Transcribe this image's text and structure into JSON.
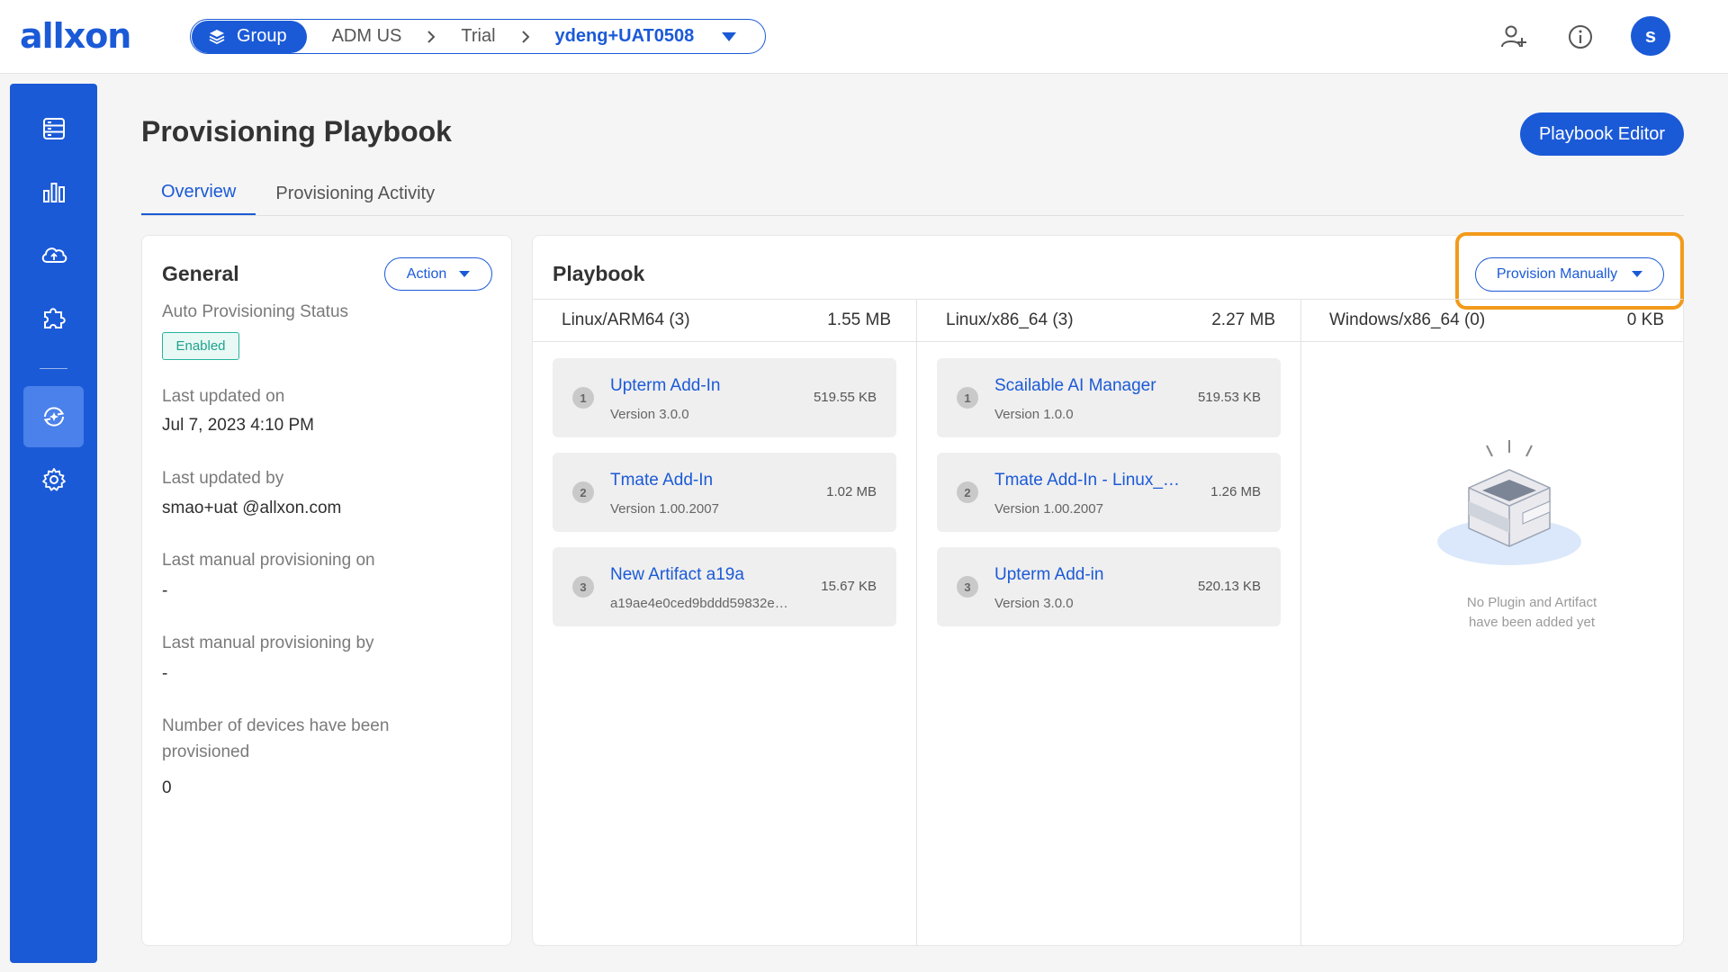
{
  "header": {
    "logo": "allxon",
    "breadcrumb": {
      "group_label": "Group",
      "items": [
        "ADM US",
        "Trial"
      ],
      "current": "ydeng+UAT0508"
    },
    "avatar_initial": "s"
  },
  "sidebar": {
    "items": [
      "devices",
      "analytics",
      "cloud-sync",
      "plugins",
      "provisioning",
      "settings"
    ],
    "active": "provisioning"
  },
  "page": {
    "title": "Provisioning Playbook",
    "editor_button": "Playbook Editor",
    "tabs": [
      {
        "label": "Overview",
        "active": true
      },
      {
        "label": "Provisioning Activity",
        "active": false
      }
    ]
  },
  "general": {
    "title": "General",
    "action_label": "Action",
    "auto_status_label": "Auto Provisioning Status",
    "auto_status_value": "Enabled",
    "last_updated_on_label": "Last updated on",
    "last_updated_on_value": "Jul 7, 2023 4:10 PM",
    "last_updated_by_label": "Last updated by",
    "last_updated_by_value": "smao+uat @allxon.com",
    "last_manual_on_label": "Last manual provisioning on",
    "last_manual_on_value": "-",
    "last_manual_by_label": "Last manual provisioning by",
    "last_manual_by_value": "-",
    "devices_label": "Number of devices have been provisioned",
    "devices_value": "0"
  },
  "playbook": {
    "title": "Playbook",
    "provision_label": "Provision Manually",
    "columns": [
      {
        "name": "Linux/ARM64 (3)",
        "size": "1.55 MB",
        "items": [
          {
            "num": "1",
            "name": "Upterm Add-In",
            "sub": "Version 3.0.0",
            "size": "519.55 KB"
          },
          {
            "num": "2",
            "name": "Tmate Add-In",
            "sub": "Version 1.00.2007",
            "size": "1.02 MB"
          },
          {
            "num": "3",
            "name": "New Artifact a19a",
            "sub": "a19ae4e0ced9bddd59832e…",
            "size": "15.67 KB"
          }
        ]
      },
      {
        "name": "Linux/x86_64 (3)",
        "size": "2.27 MB",
        "items": [
          {
            "num": "1",
            "name": "Scailable AI Manager",
            "sub": "Version 1.0.0",
            "size": "519.53 KB"
          },
          {
            "num": "2",
            "name": "Tmate Add-In - Linux_…",
            "sub": "Version 1.00.2007",
            "size": "1.26 MB"
          },
          {
            "num": "3",
            "name": "Upterm Add-in",
            "sub": "Version 3.0.0",
            "size": "520.13 KB"
          }
        ]
      },
      {
        "name": "Windows/x86_64 (0)",
        "size": "0 KB",
        "empty_line1": "No Plugin and Artifact",
        "empty_line2": "have been added yet"
      }
    ]
  },
  "colors": {
    "brand": "#1b5ad7",
    "highlight": "#f29a1b",
    "enabled": "#1fa38c"
  }
}
